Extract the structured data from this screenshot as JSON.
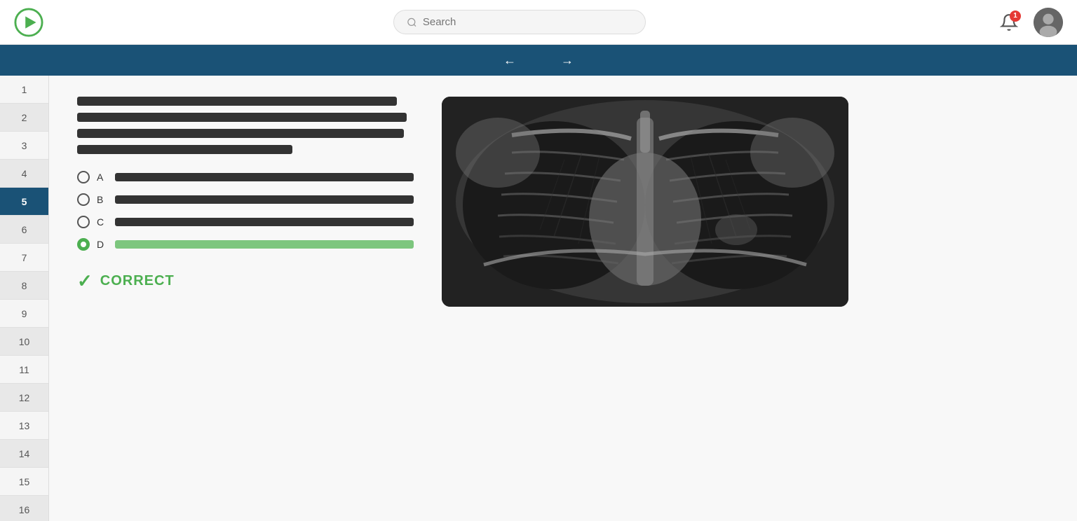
{
  "header": {
    "logo_label": "Play icon",
    "search_placeholder": "Search",
    "notification_count": "1",
    "avatar_label": "User avatar"
  },
  "nav": {
    "prev_arrow": "←",
    "next_arrow": "→"
  },
  "sidebar": {
    "items": [
      {
        "number": "1",
        "active": false
      },
      {
        "number": "2",
        "active": false
      },
      {
        "number": "3",
        "active": false
      },
      {
        "number": "4",
        "active": false
      },
      {
        "number": "5",
        "active": true
      },
      {
        "number": "6",
        "active": false
      },
      {
        "number": "7",
        "active": false
      },
      {
        "number": "8",
        "active": false
      },
      {
        "number": "9",
        "active": false
      },
      {
        "number": "10",
        "active": false
      },
      {
        "number": "11",
        "active": false
      },
      {
        "number": "12",
        "active": false
      },
      {
        "number": "13",
        "active": false
      },
      {
        "number": "14",
        "active": false
      },
      {
        "number": "15",
        "active": false
      },
      {
        "number": "16",
        "active": false
      }
    ]
  },
  "question": {
    "text_lines": [
      420,
      420,
      420,
      280
    ],
    "options": [
      {
        "letter": "A",
        "selected": false,
        "correct": false,
        "bar_width": "95%"
      },
      {
        "letter": "B",
        "selected": false,
        "correct": false,
        "bar_width": "90%"
      },
      {
        "letter": "C",
        "selected": false,
        "correct": false,
        "bar_width": "88%"
      },
      {
        "letter": "D",
        "selected": true,
        "correct": true,
        "bar_width": "95%"
      }
    ],
    "result_label": "CORRECT",
    "result_icon": "✓"
  }
}
